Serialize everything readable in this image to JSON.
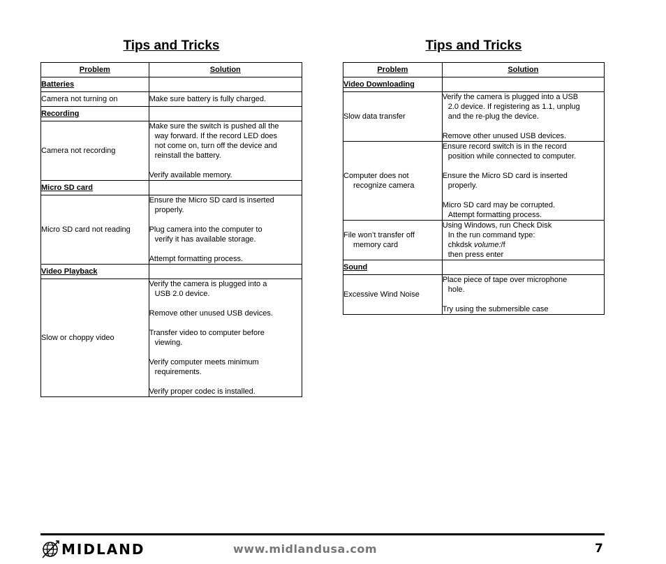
{
  "left": {
    "title": "Tips and Tricks",
    "header": {
      "problem": "Problem",
      "solution": "Solution"
    },
    "sections": [
      {
        "category": "Batteries",
        "rows": [
          {
            "problem": [
              "Camera not turning on"
            ],
            "solution": [
              [
                "Make sure battery is fully charged."
              ]
            ]
          }
        ]
      },
      {
        "category": "Recording",
        "rows": [
          {
            "problem": [
              "Camera not recording"
            ],
            "solution": [
              [
                "Make sure the switch is pushed all the",
                "way forward.  If the record LED does",
                "not come on, turn off the device and",
                "reinstall the battery."
              ],
              [
                "Verify available memory."
              ]
            ]
          }
        ]
      },
      {
        "category": "Micro SD card",
        "rows": [
          {
            "problem": [
              "Micro SD card not reading"
            ],
            "solution": [
              [
                "Ensure the Micro SD card is inserted",
                "properly."
              ],
              [
                "Plug camera into the computer to",
                "verify it has available storage."
              ],
              [
                "Attempt formatting process."
              ]
            ]
          }
        ]
      },
      {
        "category": "Video Playback",
        "rows": [
          {
            "problem": [
              "Slow or choppy video"
            ],
            "solution": [
              [
                "Verify the camera is plugged into a",
                "USB 2.0 device."
              ],
              [
                "Remove other unused USB devices."
              ],
              [
                "Transfer video to computer before",
                "viewing."
              ],
              [
                "Verify computer meets minimum",
                "requirements."
              ],
              [
                "Verify proper codec is installed."
              ]
            ]
          }
        ]
      }
    ]
  },
  "right": {
    "title": "Tips and Tricks",
    "header": {
      "problem": "Problem",
      "solution": "Solution"
    },
    "sections": [
      {
        "category": "Video Downloading",
        "rows": [
          {
            "problem": [
              "Slow data transfer"
            ],
            "solution": [
              [
                "Verify the camera is plugged into a USB",
                "2.0 device.  If registering as 1.1, unplug",
                "and the re-plug the device."
              ],
              [
                "Remove other unused USB devices."
              ]
            ]
          },
          {
            "problem": [
              "Computer does not",
              "recognize camera"
            ],
            "solution": [
              [
                "Ensure record switch is in the record",
                "position while connected to computer."
              ],
              [
                "Ensure the Micro SD card is inserted",
                "properly."
              ],
              [
                "Micro SD card may be corrupted.",
                "Attempt formatting process."
              ]
            ]
          },
          {
            "problem": [
              "File won’t transfer off",
              "memory card"
            ],
            "solution": [
              [
                "Using Windows, run Check Disk",
                "In the run command type:",
                "chkdsk volume:/f",
                "then press enter"
              ]
            ]
          }
        ]
      },
      {
        "category": "Sound",
        "rows": [
          {
            "problem": [
              "Excessive Wind Noise"
            ],
            "solution": [
              [
                "Place piece of tape over microphone",
                "hole."
              ],
              [
                "Try using the submersible case"
              ]
            ]
          }
        ]
      }
    ]
  },
  "footer": {
    "brand": "MIDLAND",
    "logo_icon": "globe-icon",
    "url": "www.midlandusa.com",
    "page_number": "7"
  }
}
